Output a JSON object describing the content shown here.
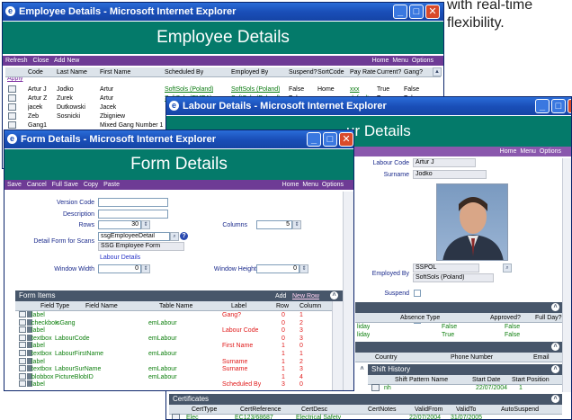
{
  "caption": {
    "line1": "with real-time",
    "line2": "flexibility."
  },
  "employee_window": {
    "title": "Employee Details - Microsoft Internet Explorer",
    "banner": "Employee Details",
    "links_left": [
      "Refresh",
      "Close",
      "Add New"
    ],
    "links_right": [
      "Home",
      "Menu",
      "Options"
    ],
    "apply": "Apply",
    "columns": [
      "Code",
      "Last Name",
      "First Name",
      "Scheduled By",
      "Employed By",
      "Suspend?",
      "SortCode",
      "Pay Rate",
      "Current?",
      "Gang?"
    ],
    "rows": [
      {
        "code": "Artur J",
        "last": "Jodko",
        "first": "Artur",
        "sched": "SoftSols (Poland)",
        "emp": "SoftSols (Poland)",
        "suspend": "False",
        "sort": "Home",
        "pay": "xxx",
        "current": "True",
        "gang": "False"
      },
      {
        "code": "Artur Z",
        "last": "Zurek",
        "first": "Artur",
        "sched": "SoftSols (EMEA)",
        "emp": "SoftSols (Poland)",
        "suspend": "False",
        "sort": "",
        "pay": "default",
        "current": "True",
        "gang": "False"
      },
      {
        "code": "jacek",
        "last": "Dutkowski",
        "first": "Jacek",
        "sched": "",
        "emp": "",
        "suspend": "",
        "sort": "",
        "pay": "",
        "current": "",
        "gang": ""
      },
      {
        "code": "Zeb",
        "last": "Sosnicki",
        "first": "Zbigniew",
        "sched": "",
        "emp": "",
        "suspend": "",
        "sort": "",
        "pay": "",
        "current": "",
        "gang": ""
      },
      {
        "code": "Gang1",
        "last": "",
        "first": "Mixed Gang Number 1",
        "sched": "",
        "emp": "",
        "suspend": "",
        "sort": "",
        "pay": "",
        "current": "",
        "gang": ""
      },
      {
        "code": "hip001",
        "last": "Hipkin",
        "first": "David",
        "sched": "",
        "emp": "",
        "suspend": "",
        "sort": "",
        "pay": "",
        "current": "",
        "gang": ""
      }
    ]
  },
  "labour_window": {
    "title": "Labour Details - Microsoft Internet Explorer",
    "banner": "ur Details",
    "links_right": [
      "Home",
      "Menu",
      "Options"
    ],
    "labour_code_label": "Labour Code",
    "labour_code": "Artur J",
    "surname_label": "Surname",
    "surname": "Jodko",
    "employed_by_label": "Employed By",
    "employed_by_code": "SSPOL",
    "employed_by_name": "SoftSols (Poland)",
    "suspend_label": "Suspend",
    "current_label": "Current?",
    "absence_headers": [
      "Absence Type",
      "Approved?",
      "Full Day?"
    ],
    "absence_rows": [
      {
        "type": "liday",
        "approved": "False",
        "full": "False"
      },
      {
        "type": "liday",
        "approved": "True",
        "full": "False"
      }
    ],
    "contact_headers": [
      "Country",
      "Phone Number",
      "Email"
    ],
    "shift_history_title": "Shift History",
    "shift_headers": [
      "Shift Pattern Name",
      "Start Date",
      "Start Position"
    ],
    "shift_rows": [
      {
        "name": "nh",
        "date": "22/07/2004",
        "pos": "1"
      }
    ],
    "certificates_title": "Certificates",
    "cert_headers": [
      "CertType",
      "CertReference",
      "CertDesc",
      "CertNotes",
      "ValidFrom",
      "ValidTo",
      "AutoSuspend"
    ],
    "cert_rows": [
      {
        "type": "Elec",
        "ref": "EC123/68687",
        "desc": "Electrical Safety",
        "notes": "",
        "from": "22/07/2004",
        "to": "31/07/2005",
        "auto": ""
      }
    ]
  },
  "form_window": {
    "title": "Form Details - Microsoft Internet Explorer",
    "banner": "Form Details",
    "links_left": [
      "Save",
      "Cancel",
      "Full Save",
      "Copy",
      "Paste"
    ],
    "links_right": [
      "Home",
      "Menu",
      "Options"
    ],
    "version_code_label": "Version Code",
    "description_label": "Description",
    "rows_label": "Rows",
    "rows_value": "30",
    "columns_label": "Columns",
    "columns_value": "5",
    "detail_form_label": "Detail Form for Scans",
    "detail_form_value": "ssgEmployeeDetail",
    "detail_form_name": "SSG Employee Form",
    "labour_details_link": "Labour Details",
    "window_width_label": "Window Width",
    "window_width": "0",
    "window_height_label": "Window Height",
    "window_height": "0",
    "form_items_title": "Form Items",
    "form_items_add": "Add",
    "form_items_new_row": "New Row",
    "item_headers": [
      "Field Type",
      "Field Name",
      "Table Name",
      "Label",
      "Row",
      "Column"
    ],
    "items": [
      {
        "type": "label",
        "name": "",
        "table": "",
        "label": "Gang?",
        "row": "0",
        "col": "1"
      },
      {
        "type": "checkbox",
        "name": "IsGang",
        "table": "emLabour",
        "label": "",
        "row": "0",
        "col": "2"
      },
      {
        "type": "label",
        "name": "",
        "table": "",
        "label": "Labour Code",
        "row": "0",
        "col": "3"
      },
      {
        "type": "textbox",
        "name": "LabourCode",
        "table": "emLabour",
        "label": "",
        "row": "0",
        "col": "3"
      },
      {
        "type": "label",
        "name": "",
        "table": "",
        "label": "First Name",
        "row": "1",
        "col": "0"
      },
      {
        "type": "textbox",
        "name": "LabourFirstName",
        "table": "emLabour",
        "label": "",
        "row": "1",
        "col": "1"
      },
      {
        "type": "label",
        "name": "",
        "table": "",
        "label": "Surname",
        "row": "1",
        "col": "2"
      },
      {
        "type": "textbox",
        "name": "LabourSurName",
        "table": "emLabour",
        "label": "Surname",
        "row": "1",
        "col": "3"
      },
      {
        "type": "blobbox",
        "name": "PictureBlobID",
        "table": "emLabour",
        "label": "",
        "row": "1",
        "col": "4"
      },
      {
        "type": "label",
        "name": "",
        "table": "",
        "label": "Scheduled By",
        "row": "3",
        "col": "0"
      }
    ]
  }
}
